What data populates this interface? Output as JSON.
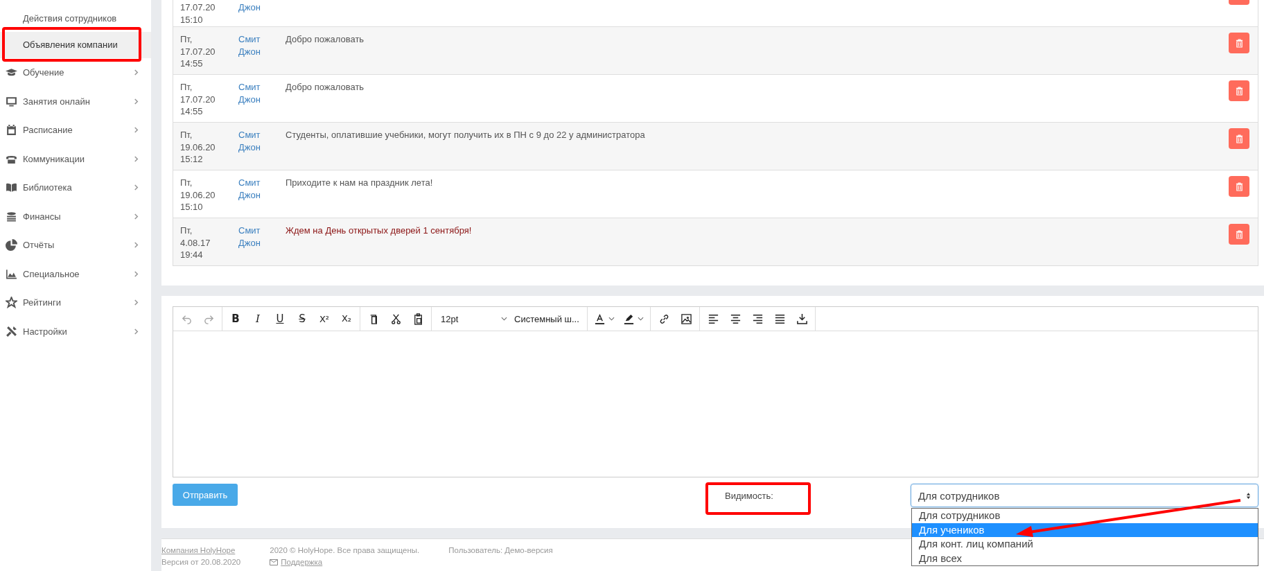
{
  "sidebar": {
    "subitems": [
      {
        "label": "Действия сотрудников",
        "selected": false
      },
      {
        "label": "Объявления компании",
        "selected": true
      }
    ],
    "items": [
      {
        "label": "Обучение",
        "kind": "graduation"
      },
      {
        "label": "Занятия онлайн",
        "kind": "monitor"
      },
      {
        "label": "Расписание",
        "kind": "calendar"
      },
      {
        "label": "Коммуникации",
        "kind": "phone"
      },
      {
        "label": "Библиотека",
        "kind": "book"
      },
      {
        "label": "Финансы",
        "kind": "coins"
      },
      {
        "label": "Отчёты",
        "kind": "pie"
      },
      {
        "label": "Специальное",
        "kind": "chart"
      },
      {
        "label": "Рейтинги",
        "kind": "star"
      },
      {
        "label": "Настройки",
        "kind": "tools"
      }
    ]
  },
  "announcements": [
    {
      "date": "17.07.20 15:10",
      "author": "Джон"
    },
    {
      "date": "Пт, 17.07.20 14:55",
      "author": "Смит Джон",
      "message": "Добро пожаловать",
      "important": false
    },
    {
      "date": "Пт, 17.07.20 14:55",
      "author": "Смит Джон",
      "message": "Добро пожаловать",
      "important": false
    },
    {
      "date": "Пт, 19.06.20 15:12",
      "author": "Смит Джон",
      "message": "Студенты, оплатившие учебники, могут получить их в ПН с 9 до 22 у администратора",
      "important": false
    },
    {
      "date": "Пт, 19.06.20 15:10",
      "author": "Смит Джон",
      "message": "Приходите к нам на праздник лета!",
      "important": false
    },
    {
      "date": "Пт, 4.08.17 19:44",
      "author": "Смит Джон",
      "message": "Ждем на День открытых дверей 1 сентября!",
      "important": true
    }
  ],
  "toolbar": [
    [
      {
        "kind": "undo",
        "disabled": true
      },
      {
        "kind": "redo",
        "disabled": true
      }
    ],
    [
      {
        "kind": "bold",
        "label": "B",
        "disabled": false
      },
      {
        "kind": "italic",
        "label": "I",
        "disabled": false
      },
      {
        "kind": "underline",
        "label": "U",
        "disabled": false
      },
      {
        "kind": "strike",
        "label": "S",
        "disabled": false
      },
      {
        "kind": "sup",
        "label": "X²",
        "disabled": false
      },
      {
        "kind": "sub",
        "label": "X₂",
        "disabled": false
      }
    ],
    [
      {
        "kind": "copy",
        "disabled": false
      },
      {
        "kind": "cut",
        "disabled": false
      },
      {
        "kind": "paste",
        "disabled": false
      }
    ],
    [
      {
        "kind": "select",
        "label": "12pt",
        "disabled": false
      },
      {
        "kind": "select",
        "label": "Системный ш...",
        "disabled": false
      }
    ],
    [
      {
        "kind": "text-color",
        "disabled": false
      },
      {
        "kind": "highlight",
        "disabled": false
      }
    ],
    [
      {
        "kind": "link",
        "disabled": false
      },
      {
        "kind": "image",
        "disabled": false
      }
    ],
    [
      {
        "kind": "align-left",
        "disabled": false
      },
      {
        "kind": "align-center",
        "disabled": false
      },
      {
        "kind": "align-right",
        "disabled": false
      },
      {
        "kind": "justify",
        "disabled": false
      },
      {
        "kind": "download",
        "disabled": false
      }
    ]
  ],
  "send_button": "Отправить",
  "visibility": {
    "label": "Видимость:",
    "value": "Для сотрудников",
    "expanded": true,
    "options": [
      {
        "label": "Для сотрудников",
        "highlighted": false
      },
      {
        "label": "Для учеников",
        "highlighted": true
      },
      {
        "label": "Для конт. лиц компаний",
        "highlighted": false
      },
      {
        "label": "Для всех",
        "highlighted": false
      }
    ]
  },
  "footer": {
    "company_link": "Компания HolyHope",
    "version": "Версия от 20.08.2020",
    "copyright": "2020 © HolyHope. Все права защищены.",
    "support_link": "Поддержка",
    "user": "Пользователь: Демо-версия"
  }
}
